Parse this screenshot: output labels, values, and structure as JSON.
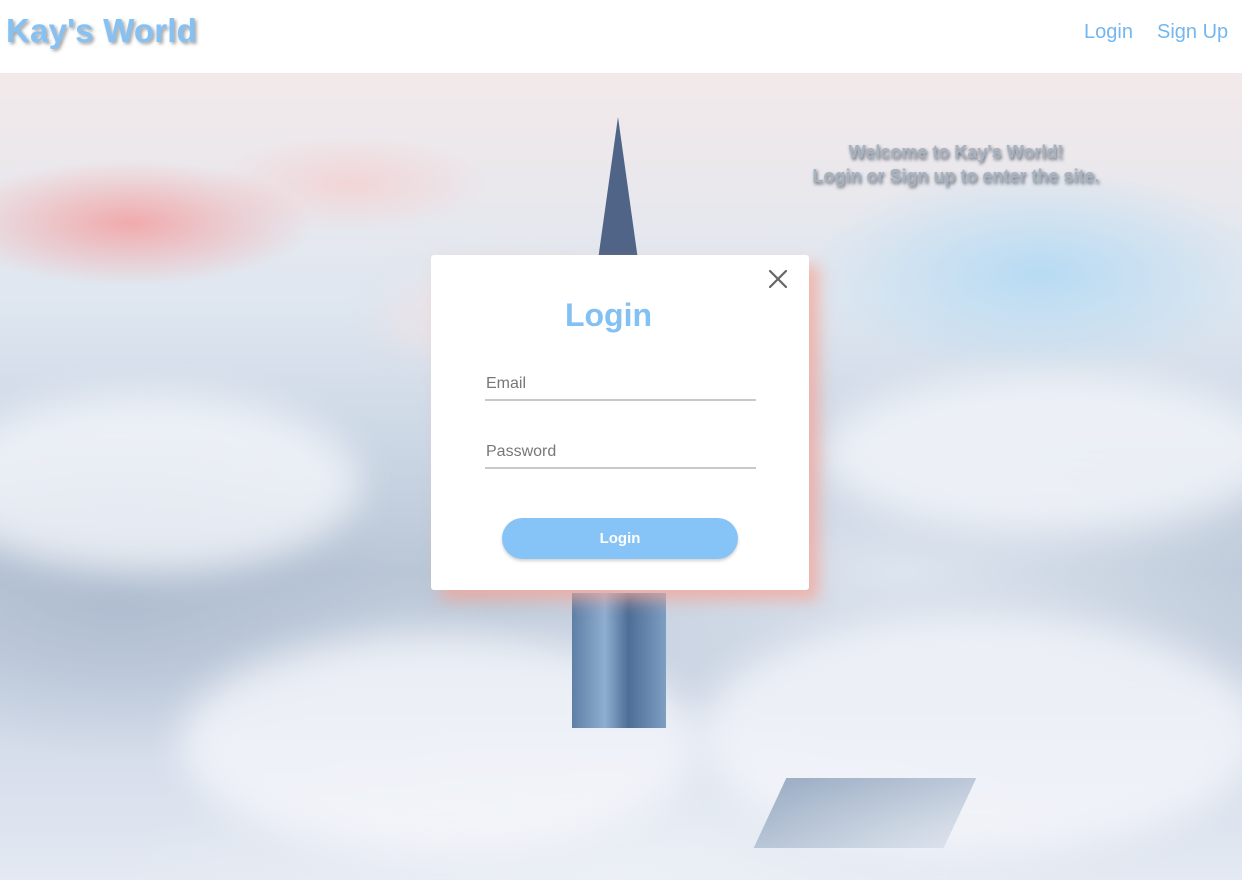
{
  "header": {
    "brand": "Kay's World",
    "nav": {
      "login_label": "Login",
      "signup_label": "Sign Up"
    }
  },
  "welcome": {
    "line1": "Welcome to Kay's World!",
    "line2": "Login or Sign up to enter the site."
  },
  "modal": {
    "title": "Login",
    "close_icon": "close-icon",
    "email": {
      "value": "",
      "placeholder": "Email"
    },
    "password": {
      "value": "",
      "placeholder": "Password"
    },
    "submit_label": "Login"
  },
  "colors": {
    "accent": "#86c1f3",
    "modal_shadow": "#f6a496",
    "header_bg": "#ffffff"
  }
}
